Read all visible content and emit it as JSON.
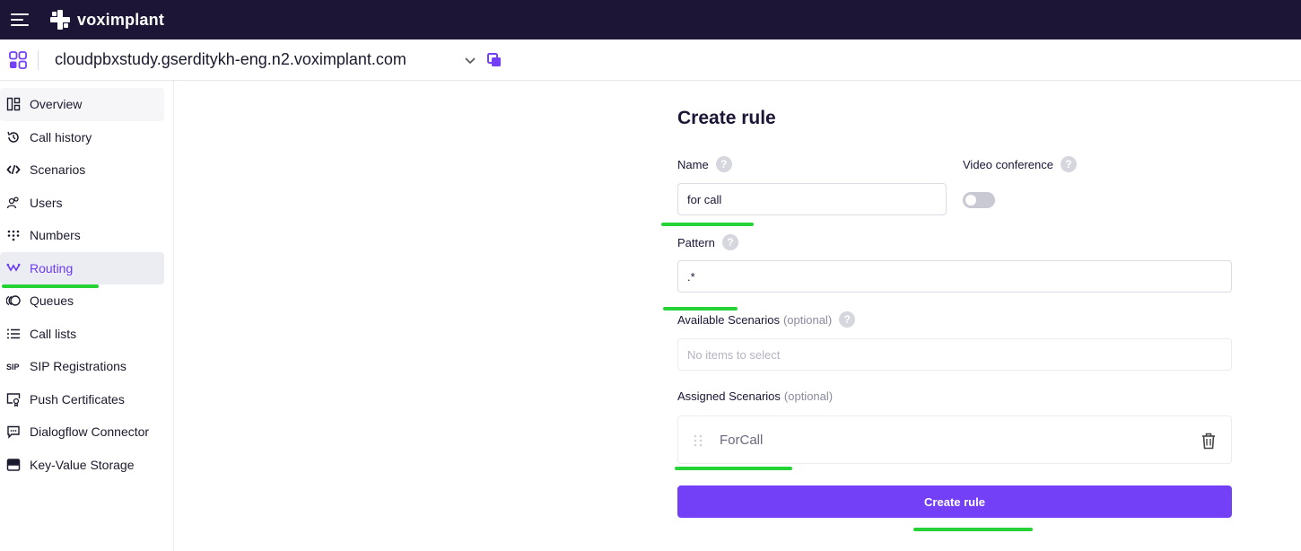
{
  "topbar": {
    "brand": "voximplant"
  },
  "domainbar": {
    "domain": "cloudpbxstudy.gserditykh-eng.n2.voximplant.com"
  },
  "sidebar": {
    "items": [
      {
        "label": "Overview",
        "icon": "overview-icon"
      },
      {
        "label": "Call history",
        "icon": "history-icon"
      },
      {
        "label": "Scenarios",
        "icon": "code-icon"
      },
      {
        "label": "Users",
        "icon": "users-icon"
      },
      {
        "label": "Numbers",
        "icon": "dialpad-icon"
      },
      {
        "label": "Routing",
        "icon": "routing-icon"
      },
      {
        "label": "Queues",
        "icon": "queues-icon"
      },
      {
        "label": "Call lists",
        "icon": "list-icon"
      },
      {
        "label": "SIP Registrations",
        "icon": "sip-icon"
      },
      {
        "label": "Push Certificates",
        "icon": "certificate-icon"
      },
      {
        "label": "Dialogflow Connector",
        "icon": "dialogflow-icon"
      },
      {
        "label": "Key-Value Storage",
        "icon": "storage-icon"
      }
    ],
    "active": "Routing"
  },
  "form": {
    "title": "Create rule",
    "name_label": "Name",
    "name_value": "for call",
    "video_label": "Video conference",
    "pattern_label": "Pattern",
    "pattern_value": ".*",
    "available_label": "Available Scenarios",
    "optional": "(optional)",
    "available_placeholder": "No items to select",
    "assigned_label": "Assigned Scenarios",
    "assigned_item": "ForCall",
    "submit_label": "Create rule"
  },
  "colors": {
    "brand_dark": "#1c1536",
    "accent": "#7440f7",
    "highlight": "#26d336"
  }
}
